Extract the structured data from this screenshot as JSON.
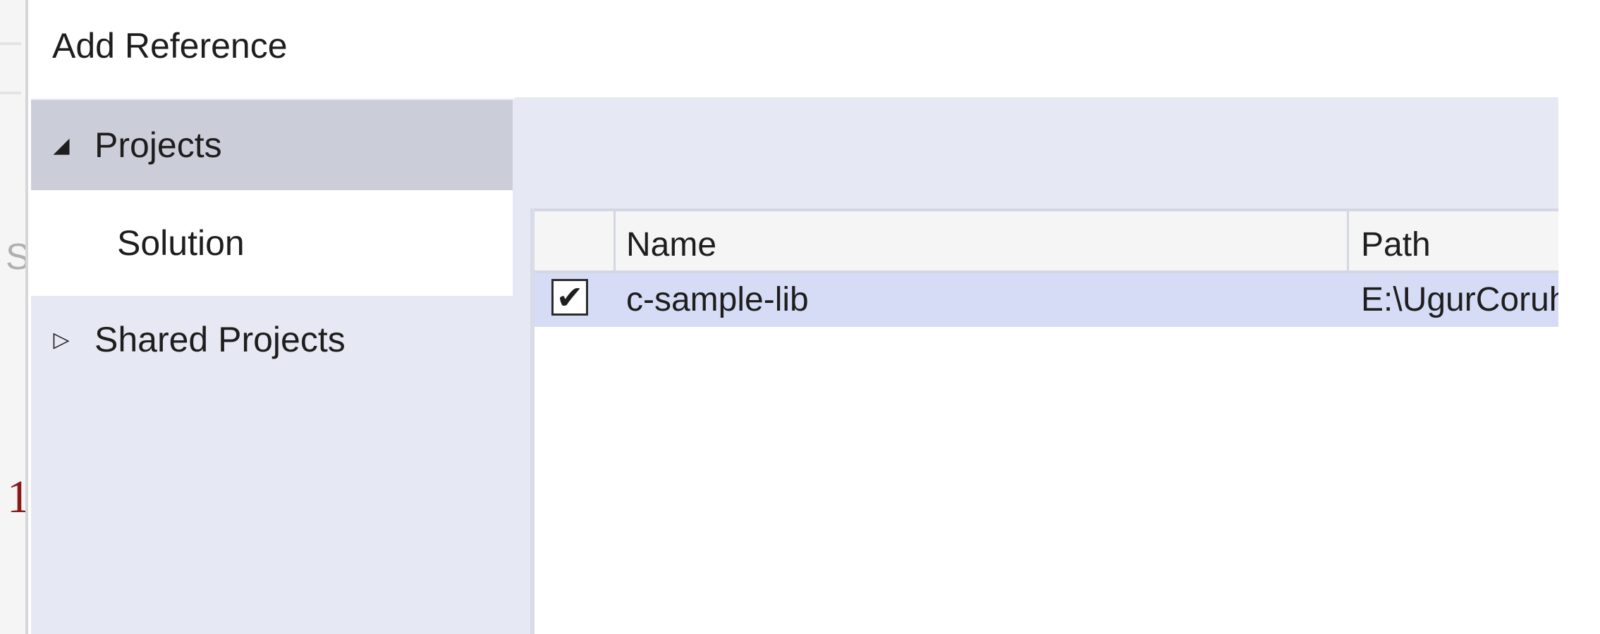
{
  "background_editor": {
    "gutter_letter": "S",
    "line_number": "1"
  },
  "dialog": {
    "title": "Add Reference"
  },
  "tree": {
    "items": [
      {
        "label": "Projects",
        "expanded": true,
        "arrow_icon": "triangle-expanded-icon"
      },
      {
        "label": "Solution",
        "selected": true
      },
      {
        "label": "Shared Projects",
        "expanded": false,
        "arrow_icon": "triangle-collapsed-icon"
      }
    ]
  },
  "grid": {
    "columns": [
      "",
      "Name",
      "Path"
    ],
    "rows": [
      {
        "checked": true,
        "check_glyph": "✔",
        "name": "c-sample-lib",
        "path": "E:\\UgurCoruh\\"
      }
    ]
  },
  "colors": {
    "pane_background": "#e6e9f4",
    "tree_selected_header": "#cbcdd9",
    "row_selected": "#d6dcf5"
  }
}
